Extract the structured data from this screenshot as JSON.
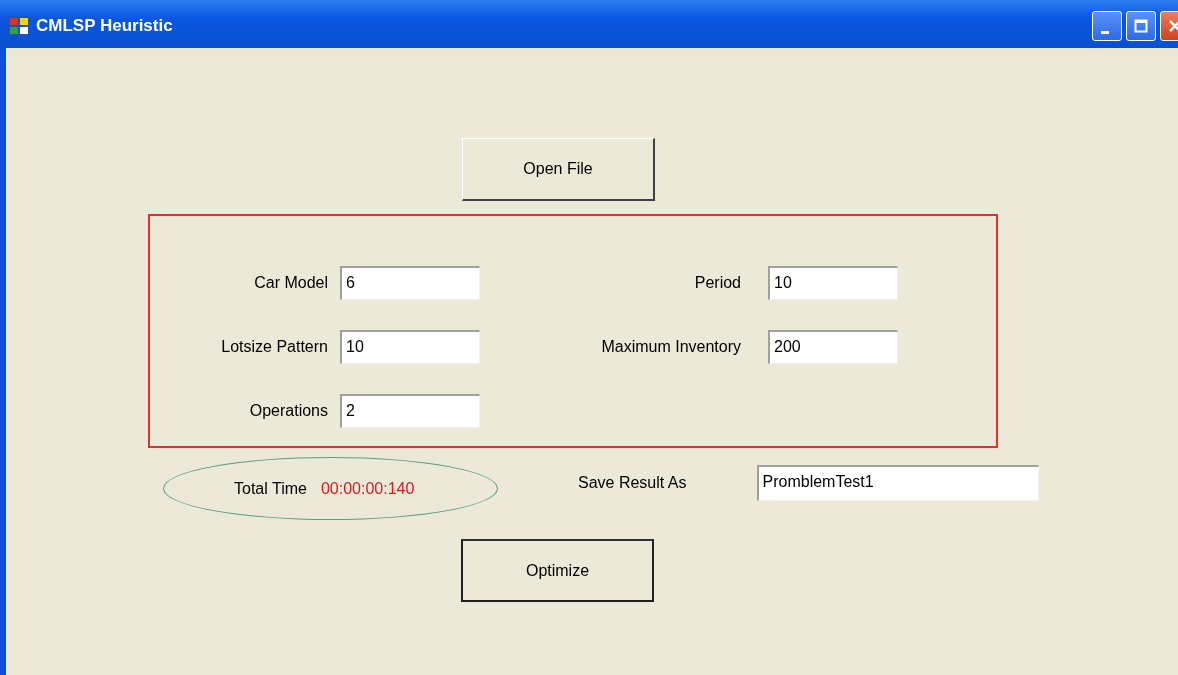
{
  "window": {
    "title": "CMLSP Heuristic"
  },
  "open_button": "Open File",
  "parameters": {
    "left": [
      {
        "label": "Car Model",
        "value": "6"
      },
      {
        "label": "Lotsize Pattern",
        "value": "10"
      },
      {
        "label": "Operations",
        "value": "2"
      }
    ],
    "right": [
      {
        "label": "Period",
        "value": "10"
      },
      {
        "label": "Maximum Inventory",
        "value": "200"
      }
    ]
  },
  "total_time": {
    "label": "Total Time",
    "value": "00:00:00:140"
  },
  "save_result": {
    "label": "Save Result As",
    "value": "PromblemTest1"
  },
  "optimize_button": "Optimize"
}
